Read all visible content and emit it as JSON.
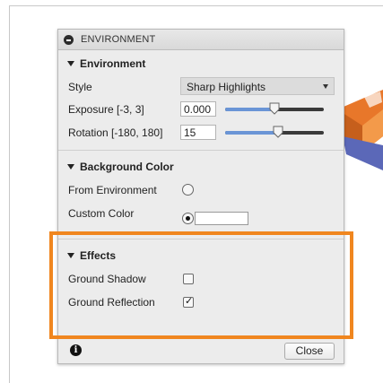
{
  "panel": {
    "title": "ENVIRONMENT",
    "sections": {
      "environment": {
        "heading": "Environment",
        "style": {
          "label": "Style",
          "value": "Sharp Highlights"
        },
        "exposure": {
          "label": "Exposure [-3, 3]",
          "value": "0.000",
          "slider_fraction": 0.5
        },
        "rotation": {
          "label": "Rotation [-180, 180]",
          "value": "15",
          "slider_fraction": 0.54
        }
      },
      "background": {
        "heading": "Background Color",
        "from_environment": {
          "label": "From Environment",
          "selected": false
        },
        "custom_color": {
          "label": "Custom Color",
          "selected": true,
          "color": "#ffffff"
        }
      },
      "effects": {
        "heading": "Effects",
        "ground_shadow": {
          "label": "Ground Shadow",
          "checked": false
        },
        "ground_reflection": {
          "label": "Ground Reflection",
          "checked": true,
          "mark": "✓"
        }
      }
    },
    "footer": {
      "info_symbol": "i",
      "close_label": "Close"
    }
  },
  "colors": {
    "highlight": "#f0861f",
    "slider_fill": "#6a95d6",
    "panel_background": "#ececec"
  }
}
